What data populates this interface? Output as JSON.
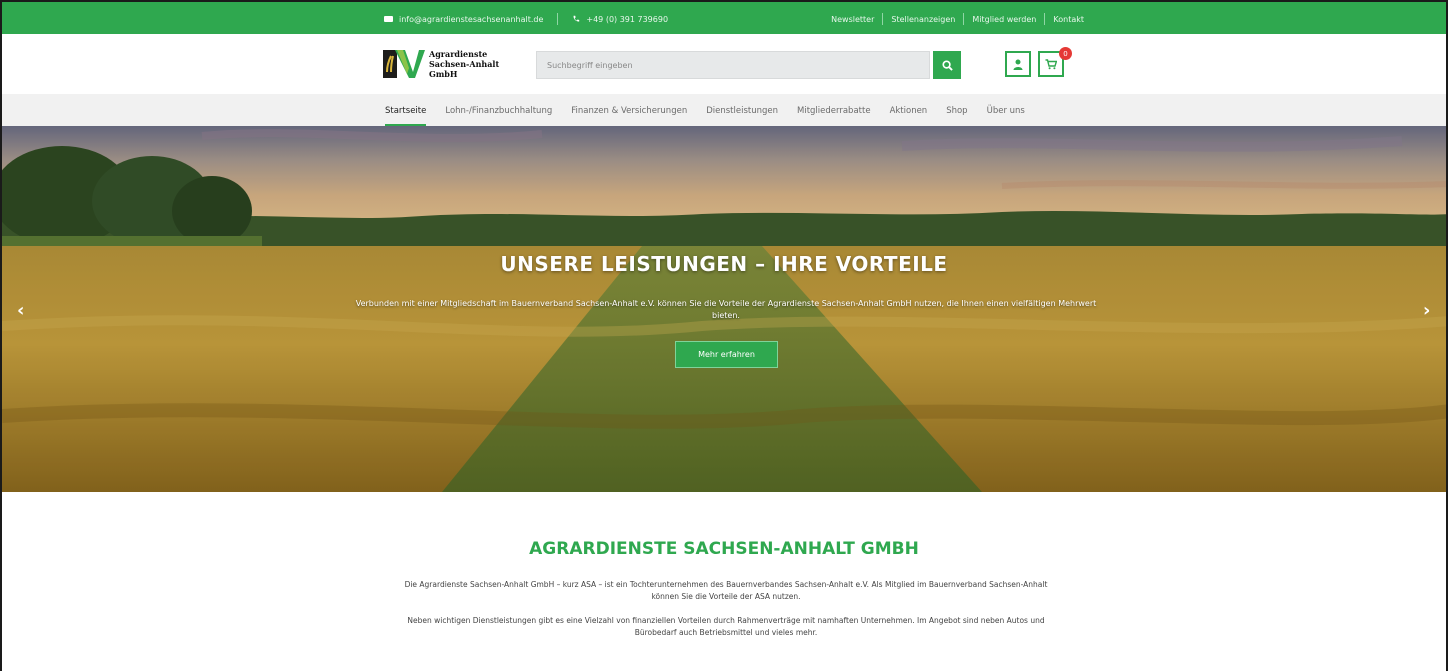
{
  "topbar": {
    "email": "info@agrardienstesachsenanhalt.de",
    "phone": "+49 (0) 391 739690",
    "links": [
      "Newsletter",
      "Stellenanzeigen",
      "Mitglied werden",
      "Kontakt"
    ]
  },
  "header": {
    "logo_line1": "Agrardienste",
    "logo_line2": "Sachsen-Anhalt",
    "logo_line3": "GmbH",
    "search_placeholder": "Suchbegriff eingeben",
    "cart_count": "0"
  },
  "nav": {
    "items": [
      "Startseite",
      "Lohn-/Finanzbuchhaltung",
      "Finanzen & Versicherungen",
      "Dienstleistungen",
      "Mitgliederrabatte",
      "Aktionen",
      "Shop",
      "Über uns"
    ],
    "active": "Startseite"
  },
  "hero": {
    "title": "UNSERE LEISTUNGEN – IHRE VORTEILE",
    "text": "Verbunden mit einer Mitgliedschaft im Bauernverband Sachsen-Anhalt e.V. können Sie die Vorteile der Agrardienste Sachsen-Anhalt GmbH nutzen, die Ihnen einen vielfältigen Mehrwert bieten.",
    "button": "Mehr erfahren",
    "prev_arrow": "‹",
    "next_arrow": "›"
  },
  "intro": {
    "title": "AGRARDIENSTE SACHSEN-ANHALT GMBH",
    "paragraph1": "Die Agrardienste Sachsen-Anhalt GmbH – kurz ASA – ist ein Tochterunternehmen des Bauernverbandes Sachsen-Anhalt e.V. Als Mitglied im Bauernverband Sachsen-Anhalt können Sie die Vorteile der ASA nutzen.",
    "paragraph2": "Neben wichtigen Dienstleistungen gibt es eine Vielzahl von finanziellen Vorteilen durch Rahmenverträge mit namhaften Unternehmen. Im Angebot sind neben Autos und Bürobedarf auch Betriebsmittel und vieles mehr."
  },
  "colors": {
    "brand_green": "#2fa84f",
    "nav_bg": "#f1f1f1",
    "badge_red": "#e53935"
  }
}
